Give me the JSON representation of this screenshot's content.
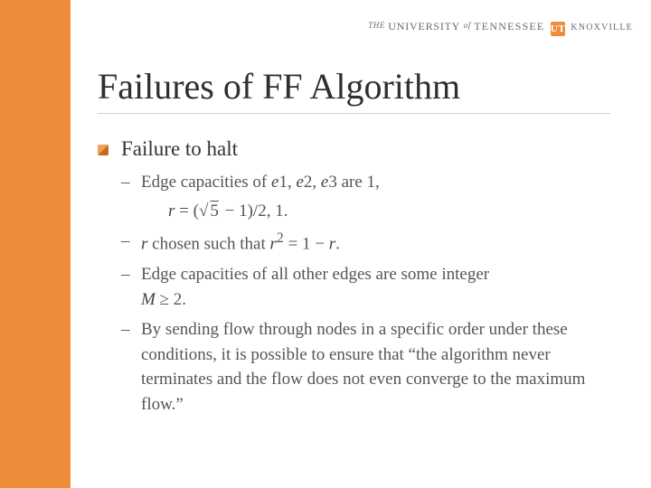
{
  "logo": {
    "the": "THE",
    "univ": "UNIVERSITY",
    "of": "of",
    "tenn": "TENNESSEE",
    "mark": "UT",
    "knox": "KNOXVILLE"
  },
  "title": "Failures of FF Algorithm",
  "bullet1": "Failure to halt",
  "sub1_prefix": "Edge capacities of ",
  "sub1_e1": "e",
  "sub1_1": "1, ",
  "sub1_e2": "e",
  "sub1_2": "2, ",
  "sub1_e3": "e",
  "sub1_3": "3 are 1,",
  "sub1_math_r": "r",
  "sub1_math_eq": " = (",
  "sub1_math_root": "√",
  "sub1_math_five": "5",
  "sub1_math_rest": " − 1)/2, 1.",
  "sub2_r": "r",
  "sub2_mid": " chosen such that ",
  "sub2_r2a": "r",
  "sub2_sup": "2",
  "sub2_eq": " = 1 − ",
  "sub2_r2b": "r",
  "sub2_dot": ".",
  "sub3_part1": "Edge capacities of all other edges are some integer",
  "sub3_M": "M",
  "sub3_ge": " ≥ 2.",
  "sub4": "By sending flow through nodes in a specific order under these conditions, it is possible to ensure that “the algorithm never terminates and the flow does not even converge to the maximum flow.”"
}
